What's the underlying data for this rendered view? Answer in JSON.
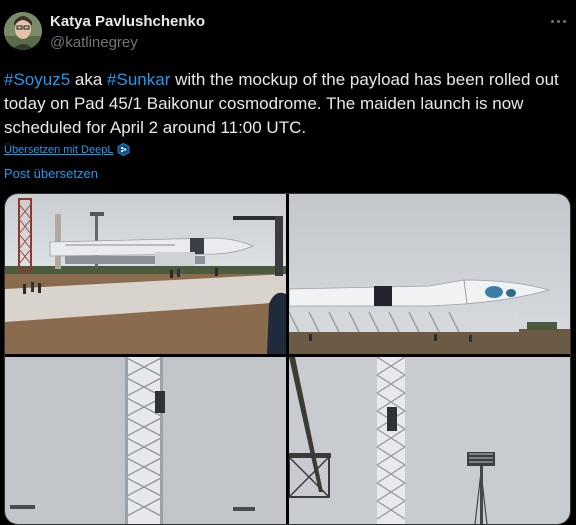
{
  "author": {
    "name": "Katya Pavlushchenko",
    "handle": "@katlinegrey"
  },
  "tweet": {
    "hashtag1": "#Soyuz5",
    "text1": " aka ",
    "hashtag2": "#Sunkar",
    "text2": " with the mockup of the payload has been rolled out today on Pad 45/1 Baikonur cosmodrome. The maiden launch is now scheduled for April 2 around 11:00 UTC."
  },
  "deepl_label": "Übersetzen mit DeepL",
  "translate_label": "Post übersetzen",
  "icons": {
    "more": "more-icon",
    "deepl": "deepl-icon",
    "avatar": "avatar-icon"
  },
  "colors": {
    "background": "#000000",
    "text": "#e7e9ea",
    "secondary": "#71767b",
    "accent": "#1d9bf0"
  }
}
